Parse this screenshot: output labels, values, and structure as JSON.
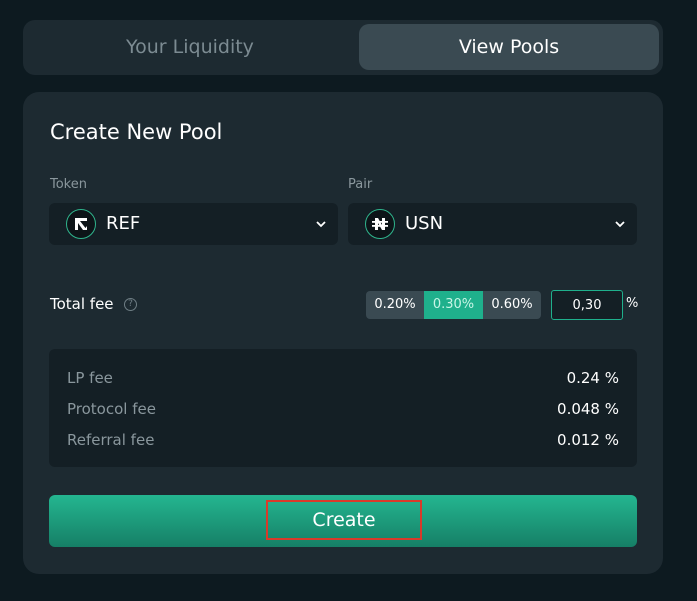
{
  "tabs": {
    "your_liquidity": "Your Liquidity",
    "view_pools": "View Pools"
  },
  "form": {
    "title": "Create New Pool",
    "token_label": "Token",
    "pair_label": "Pair",
    "token": {
      "symbol": "REF",
      "icon": "ref-token-icon"
    },
    "pair": {
      "symbol": "USN",
      "icon": "usn-token-icon"
    },
    "total_fee_label": "Total fee",
    "fee_options": [
      "0.20%",
      "0.30%",
      "0.60%"
    ],
    "selected_fee": "0.30%",
    "fee_value": "0,30",
    "fee_unit": "%"
  },
  "breakdown": [
    {
      "label": "LP fee",
      "value": "0.24 %"
    },
    {
      "label": "Protocol fee",
      "value": "0.048 %"
    },
    {
      "label": "Referral fee",
      "value": "0.012 %"
    }
  ],
  "create_label": "Create",
  "colors": {
    "accent": "#1fb08c",
    "background": "#0d1a20",
    "card": "#1d2a31",
    "highlight_frame": "#d93a2a"
  }
}
